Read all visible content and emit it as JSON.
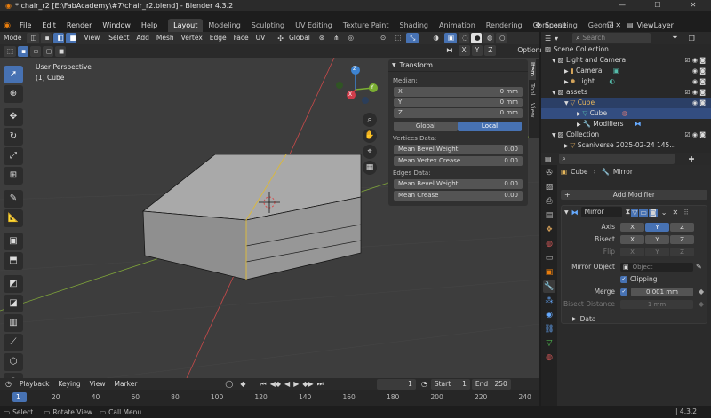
{
  "window": {
    "title": "* chair_r2 [E:\\FabAcademy\\#7\\chair_r2.blend] - Blender 4.3.2",
    "minimize": "—",
    "maximize": "☐",
    "close": "✕"
  },
  "menu": [
    "File",
    "Edit",
    "Render",
    "Window",
    "Help"
  ],
  "workspaces": [
    "Layout",
    "Modeling",
    "Sculpting",
    "UV Editing",
    "Texture Paint",
    "Shading",
    "Animation",
    "Rendering",
    "Compositing",
    "Geome"
  ],
  "active_workspace": "Layout",
  "scene": {
    "label": "Scene",
    "viewlayer": "ViewLayer"
  },
  "viewport_header": {
    "mode": "Mode",
    "menus": [
      "View",
      "Select",
      "Add",
      "Mesh",
      "Vertex",
      "Edge",
      "Face",
      "UV"
    ],
    "orientation": "Global",
    "axes": [
      "X",
      "Y",
      "Z"
    ],
    "options": "Options"
  },
  "viewport": {
    "perspective": "User Perspective",
    "object": "(1) Cube"
  },
  "gizmo": {
    "x": "X",
    "y": "Y",
    "z": "Z"
  },
  "npanel": {
    "title": "Transform",
    "median_label": "Median:",
    "median": [
      {
        "axis": "X",
        "value": "0 mm"
      },
      {
        "axis": "Y",
        "value": "0 mm"
      },
      {
        "axis": "Z",
        "value": "0 mm"
      }
    ],
    "global": "Global",
    "local": "Local",
    "vertices_label": "Vertices Data:",
    "vertices": [
      {
        "name": "Mean Bevel Weight",
        "value": "0.00"
      },
      {
        "name": "Mean Vertex Crease",
        "value": "0.00"
      }
    ],
    "edges_label": "Edges Data:",
    "edges": [
      {
        "name": "Mean Bevel Weight",
        "value": "0.00"
      },
      {
        "name": "Mean Crease",
        "value": "0.00"
      }
    ],
    "tabs": [
      "Item",
      "Tool",
      "View"
    ]
  },
  "timeline": {
    "menus": [
      "Playback",
      "Keying",
      "View",
      "Marker"
    ],
    "current_frame": "1",
    "start_label": "Start",
    "start": "1",
    "end_label": "End",
    "end": "250",
    "ticks": [
      "1",
      "20",
      "40",
      "60",
      "80",
      "100",
      "120",
      "140",
      "160",
      "180",
      "200",
      "220",
      "240"
    ]
  },
  "statusbar": {
    "select": "Select",
    "rotate": "Rotate View",
    "call_menu": "Call Menu",
    "version": "4.3.2"
  },
  "outliner": {
    "search_placeholder": "Search",
    "rows": [
      {
        "label": "Scene Collection",
        "indent": 0
      },
      {
        "label": "Light and Camera",
        "indent": 1
      },
      {
        "label": "Camera",
        "indent": 2
      },
      {
        "label": "Light",
        "indent": 2
      },
      {
        "label": "assets",
        "indent": 1
      },
      {
        "label": "Cube",
        "indent": 2
      },
      {
        "label": "Cube",
        "indent": 3
      },
      {
        "label": "Modifiers",
        "indent": 3
      },
      {
        "label": "Collection",
        "indent": 1
      },
      {
        "label": "Scaniverse 2025-02-24 145...",
        "indent": 2
      }
    ]
  },
  "properties": {
    "breadcrumb_object": "Cube",
    "breadcrumb_modifier": "Mirror",
    "add_modifier": "Add Modifier",
    "modifier_name": "Mirror",
    "axis_label": "Axis",
    "bisect_label": "Bisect",
    "flip_label": "Flip",
    "axes": [
      "X",
      "Y",
      "Z"
    ],
    "mirror_object_label": "Mirror Object",
    "mirror_object_placeholder": "Object",
    "clipping_label": "Clipping",
    "merge_label": "Merge",
    "merge_value": "0.001 mm",
    "bisect_distance_label": "Bisect Distance",
    "bisect_distance_value": "1 mm",
    "data_label": "Data"
  },
  "colors": {
    "accent": "#4772b3",
    "x_axis": "#d13d4b",
    "y_axis": "#7bae32",
    "z_axis": "#3d83d1",
    "viewport": "#3d3d3d"
  }
}
